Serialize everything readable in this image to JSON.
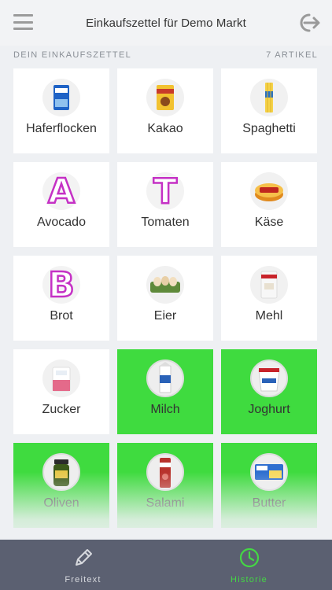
{
  "header": {
    "title": "Einkaufszettel für Demo Markt",
    "menu_icon": "hamburger-menu-icon",
    "logout_icon": "logout-icon"
  },
  "list": {
    "section_title": "DEIN EINKAUFSZETTEL",
    "item_count": "7 ARTIKEL"
  },
  "items": [
    {
      "label": "Haferflocken",
      "icon": "oat-flakes-package-icon",
      "active": false
    },
    {
      "label": "Kakao",
      "icon": "cocoa-package-icon",
      "active": false
    },
    {
      "label": "Spaghetti",
      "icon": "spaghetti-package-icon",
      "active": false
    },
    {
      "label": "Avocado",
      "letter": "A",
      "active": false
    },
    {
      "label": "Tomaten",
      "letter": "T",
      "active": false
    },
    {
      "label": "Käse",
      "icon": "cheese-wheel-icon",
      "active": false
    },
    {
      "label": "Brot",
      "letter": "B",
      "active": false
    },
    {
      "label": "Eier",
      "icon": "egg-carton-icon",
      "active": false
    },
    {
      "label": "Mehl",
      "icon": "flour-package-icon",
      "active": false
    },
    {
      "label": "Zucker",
      "icon": "sugar-package-icon",
      "active": false
    },
    {
      "label": "Milch",
      "icon": "milk-carton-icon",
      "active": true
    },
    {
      "label": "Joghurt",
      "icon": "yogurt-cup-icon",
      "active": true
    },
    {
      "label": "Oliven",
      "icon": "olive-jar-icon",
      "active": true
    },
    {
      "label": "Salami",
      "icon": "salami-package-icon",
      "active": true
    },
    {
      "label": "Butter",
      "icon": "butter-package-icon",
      "active": true
    }
  ],
  "tabs": [
    {
      "label": "Freitext",
      "icon": "pencil-icon",
      "active": false
    },
    {
      "label": "Historie",
      "icon": "clock-icon",
      "active": true
    }
  ],
  "colors": {
    "active_tile": "#3fdb3f",
    "letter_stroke": "#c531c5",
    "tabbar": "#5b6071",
    "tab_active": "#44d844"
  }
}
